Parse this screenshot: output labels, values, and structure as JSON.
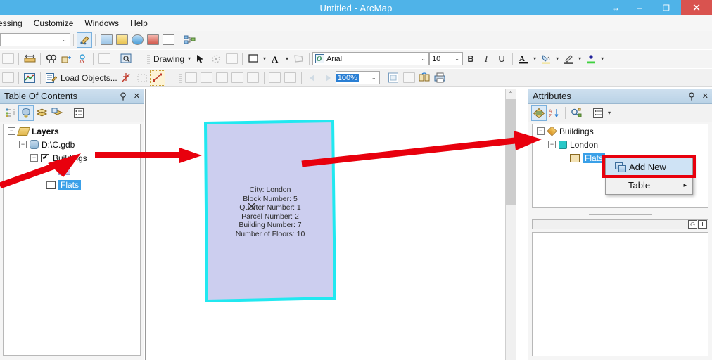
{
  "window": {
    "title": "Untitled - ArcMap",
    "buttons": {
      "resize": "↔",
      "minimize": "–",
      "restore": "❐",
      "close": "✕"
    }
  },
  "menubar": {
    "items": [
      {
        "label": "essing"
      },
      {
        "label": "Customize"
      },
      {
        "label": "Windows"
      },
      {
        "label": "Help"
      }
    ]
  },
  "toolbars": {
    "row1": {
      "layer_combo_value": "",
      "caret": "⌄",
      "icons": [
        "edit-tool-icon",
        "table-window-icon",
        "catalog-icon",
        "search-globe-icon",
        "toolbox-icon",
        "python-window-icon",
        "model-builder-icon"
      ],
      "overflow": "≡"
    },
    "row2": {
      "icons": [
        "measure-icon",
        "find-icon",
        "hyperlink-icon",
        "go-to-xy-icon",
        "time-slider-icon",
        "viewer-window-icon"
      ],
      "drawing_label": "Drawing",
      "drawing_caret": "▾",
      "select_icon": "select-arrow-icon",
      "rotate_icon": "rotate-icon",
      "order_icon": "arrange-icon",
      "fill_icon": "fill-color-icon",
      "text_icon": "text-color-icon",
      "font_name": "Arial",
      "font_size": "10",
      "bold": "B",
      "italic": "I",
      "underline": "U",
      "font_color_icon": "font-color-icon",
      "fill_color_icon": "fill-color-swatch-icon",
      "line_color_icon": "line-color-icon",
      "marker_color_icon": "marker-color-icon"
    },
    "row3": {
      "editor_icon": "editor-icon",
      "attributes_icon": "attributes-icon",
      "load_objects_label": "Load Objects...",
      "sketch_icon": "sketch-tool-icon",
      "trace_icon": "trace-icon",
      "edit_vertices_icon": "edit-vertices-icon",
      "nav_icons": [
        "zoom-in-icon",
        "zoom-out-icon",
        "pan-icon",
        "full-extent-icon",
        "fixed-zoom-icon",
        "zoom-layer-icon",
        "zoom-selection-icon",
        "back-extent-icon",
        "forward-extent-icon"
      ],
      "zoom_value": "100%",
      "zoom_caret": "⌄",
      "page_icons": [
        "page-layout-icon",
        "data-frame-icon",
        "refresh-icon",
        "print-preview-icon"
      ]
    }
  },
  "toc": {
    "title": "Table Of Contents",
    "pin": "⚓",
    "close": "✕",
    "toolbar_icons": [
      "list-by-drawing-order-icon",
      "list-by-source-icon",
      "list-by-visibility-icon",
      "list-by-selection-icon",
      "options-icon"
    ],
    "tree": [
      {
        "label": "Layers",
        "expander": "−",
        "icon": "layers-icon",
        "bold": true
      },
      {
        "label": "D:\\C.gdb",
        "expander": "−",
        "icon": "geodatabase-icon"
      },
      {
        "label": "Buildings",
        "expander": "−",
        "icon": "checkbox",
        "checked": "✔"
      },
      {
        "label": "",
        "icon": "symbol-swatch"
      },
      {
        "label": "Flats",
        "icon": "table-icon",
        "selected": true
      }
    ]
  },
  "map": {
    "feature_labels": [
      "City: London",
      "Block Number: 5",
      "Quarter Number: 1",
      "Parcel Number: 2",
      "Building Number: 7",
      "Number of Floors: 10"
    ],
    "polygon_fill": "#ccceef",
    "polygon_outline": "#21e8f0",
    "scroll_up_arrow": "⌃"
  },
  "attributes": {
    "title": "Attributes",
    "pin": "⚓",
    "close": "✕",
    "toolbar_icons": [
      "show-attributes-icon",
      "sort-az-icon",
      "highlight-feature-icon",
      "options-list-icon",
      "options-caret-icon"
    ],
    "tree": [
      {
        "label": "Buildings",
        "expander": "−",
        "icon": "feature-class-icon"
      },
      {
        "label": "London",
        "expander": "−",
        "icon": "feature-icon"
      },
      {
        "label": "Flats",
        "icon": "related-table-icon",
        "selected": true
      }
    ],
    "grid_icons": [
      "person-icon",
      "insert-icon"
    ]
  },
  "context_menu": {
    "items": [
      {
        "label": "Add New",
        "icon": "add-new-icon",
        "highlighted": true
      },
      {
        "label": "Table",
        "submenu_arrow": "▸",
        "highlighted": false
      }
    ]
  },
  "annotations": {
    "arrow_color": "#e8000d",
    "highlight_box_color": "#e8000d",
    "arrows": [
      {
        "name": "arrow-to-buildings-expander"
      },
      {
        "name": "arrow-from-toc-to-map"
      },
      {
        "name": "arrow-from-map-to-attributes"
      }
    ]
  }
}
